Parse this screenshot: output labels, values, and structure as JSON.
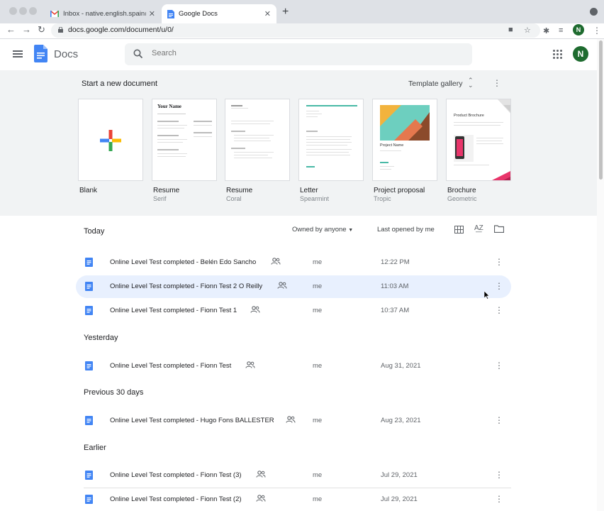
{
  "browser": {
    "tabs": [
      {
        "label": "Inbox - native.english.spain@g",
        "icon": "gmail-icon",
        "active": false
      },
      {
        "label": "Google Docs",
        "icon": "docs-icon",
        "active": true
      }
    ],
    "url": "docs.google.com/document/u/0/",
    "profile_initial": "N"
  },
  "header": {
    "title": "Docs",
    "search_placeholder": "Search",
    "avatar_initial": "N"
  },
  "templates": {
    "title": "Start a new document",
    "gallery_label": "Template gallery",
    "items": [
      {
        "name": "Blank",
        "sub": ""
      },
      {
        "name": "Resume",
        "sub": "Serif"
      },
      {
        "name": "Resume",
        "sub": "Coral"
      },
      {
        "name": "Letter",
        "sub": "Spearmint"
      },
      {
        "name": "Project proposal",
        "sub": "Tropic"
      },
      {
        "name": "Brochure",
        "sub": "Geometric"
      }
    ],
    "thumb_text": {
      "serif_name": "Your Name",
      "proposal_name": "Project Name",
      "brochure_head": "Product Brochure"
    }
  },
  "list": {
    "owned_label": "Owned by anyone",
    "sort_label": "Last opened by me",
    "sections": [
      {
        "title": "Today",
        "docs": [
          {
            "name": "Online Level Test completed - Belén Edo Sancho",
            "owner": "me",
            "date": "12:22 PM",
            "selected": false
          },
          {
            "name": "Online Level Test completed - Fionn Test 2 O Reilly",
            "owner": "me",
            "date": "11:03 AM",
            "selected": true
          },
          {
            "name": "Online Level Test completed - Fionn Test 1",
            "owner": "me",
            "date": "10:37 AM",
            "selected": false
          }
        ]
      },
      {
        "title": "Yesterday",
        "docs": [
          {
            "name": "Online Level Test completed - Fionn Test",
            "owner": "me",
            "date": "Aug 31, 2021",
            "selected": false
          }
        ]
      },
      {
        "title": "Previous 30 days",
        "docs": [
          {
            "name": "Online Level Test completed - Hugo Fons BALLESTER",
            "owner": "me",
            "date": "Aug 23, 2021",
            "selected": false
          }
        ]
      },
      {
        "title": "Earlier",
        "docs": [
          {
            "name": "Online Level Test completed - Fionn Test (3)",
            "owner": "me",
            "date": "Jul 29, 2021",
            "selected": false
          },
          {
            "name": "Online Level Test completed - Fionn Test (2)",
            "owner": "me",
            "date": "Jul 29, 2021",
            "selected": false
          }
        ]
      }
    ]
  },
  "colors": {
    "docs_blue": "#4285f4",
    "selected_row": "#e8f0fe",
    "template_bg": "#f1f3f4",
    "avatar": "#1e6b2f"
  }
}
